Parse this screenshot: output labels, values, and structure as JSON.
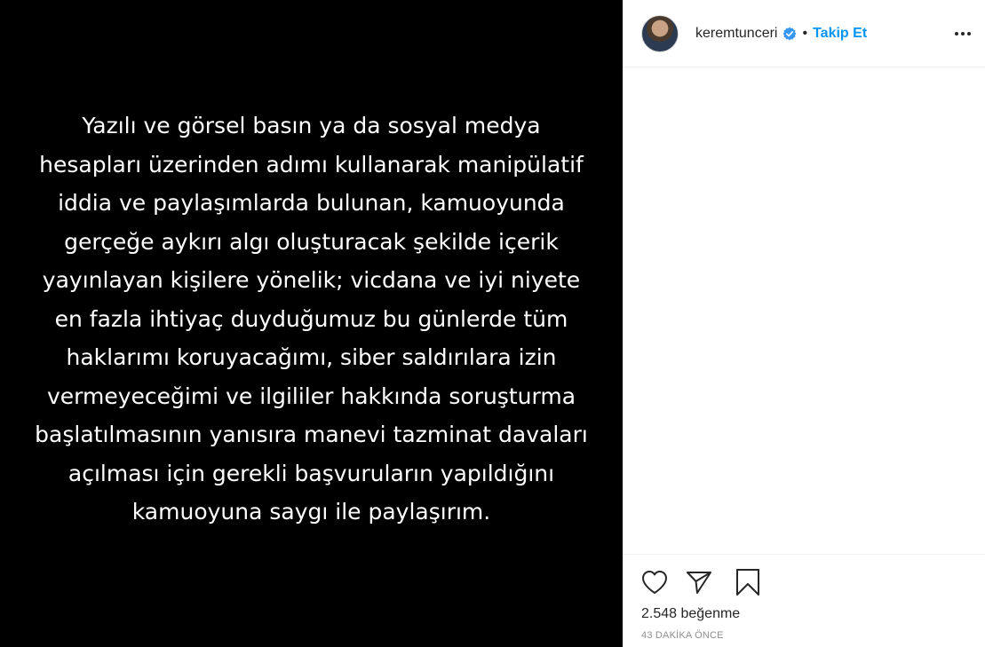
{
  "post": {
    "media_text_lines": [
      "Yazılı ve görsel basın ya da sosyal medya",
      "hesapları üzerinden adımı kullanarak manipülatif",
      "iddia ve paylaşımlarda bulunan, kamuoyunda",
      "gerçeğe aykırı algı oluşturacak şekilde içerik",
      "yayınlayan kişilere yönelik; vicdana ve iyi niyete",
      "en fazla ihtiyaç duyduğumuz bu günlerde tüm",
      "haklarımı koruyacağımı, siber saldırılara izin",
      "vermeyeceğimi ve ilgililer hakkında soruşturma",
      "başlatılmasının yanısıra manevi tazminat davaları",
      "açılması için gerekli başvuruların yapıldığını",
      "kamuoyuna saygı ile paylaşırım."
    ]
  },
  "header": {
    "username": "keremtunceri",
    "separator": "•",
    "follow_label": "Takip Et",
    "verified_icon": "verified-badge-icon",
    "more_icon": "more-options-icon"
  },
  "actions": {
    "like_icon": "heart-icon",
    "share_icon": "paper-plane-icon",
    "save_icon": "bookmark-icon",
    "likes_text": "2.548 beğenme",
    "timestamp": "43 DAKİKA ÖNCE"
  },
  "colors": {
    "accent": "#0095f6",
    "verified": "#3897f0",
    "media_bg": "#000000",
    "text": "#262626",
    "muted": "#8e8e8e"
  }
}
